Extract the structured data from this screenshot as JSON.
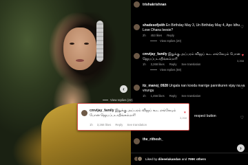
{
  "header": {
    "username": "trishakrishnan"
  },
  "comments": [
    {
      "user": "shadesofjoith",
      "text": "En Birthday May 3, Un Birthday May 4, Apo Idhu Love Dhana leesie?",
      "time": "2h",
      "likes": "453 likes",
      "reply": "Reply",
      "view_replies": "View replies (20)",
      "liked": false
    },
    {
      "user": "cmvijay_family",
      "text": "இதுக்கு அப்பரம் விஜய் கூட எங்கேயும் போன ஜெயப்படாதீங்கம்மா!!",
      "time": "1h",
      "likes": "3,268 likes",
      "reply": "Reply",
      "translate": "See translation",
      "view_replies": "View replies (59)",
      "liked": true,
      "like_count": "3,268"
    },
    {
      "user": "itz_manoj_0928",
      "text": "Ungala nan kooda marrige pannikuren vijay na va virungu",
      "time": "1h",
      "likes": "1,456 likes",
      "reply": "Reply",
      "translate": "See translation",
      "liked": false
    },
    {
      "user": "",
      "text": "respect button",
      "time": "",
      "liked": false
    },
    {
      "user": "the_rithesh_",
      "text": "",
      "time": "",
      "liked": false
    }
  ],
  "footer": {
    "prefix": "Liked by",
    "liker": "dileeelakandan",
    "conj": "and",
    "others": "799K others"
  },
  "popup": {
    "view_replies": "View replies (22)",
    "user": "cmvijay_family",
    "text": "இதுக்கு அப்பரம் விஜய் கூட எங்கேயும் போன ஜெயப்படாதீங்கம்மா!!",
    "time": "1h",
    "likes": "3,268 likes",
    "reply": "Reply",
    "translate": "See translation",
    "like_count": "3,268"
  },
  "icons": {
    "heart": "heart-icon",
    "chevron_left": "chevron-left-icon",
    "chevron_right": "chevron-right-icon"
  },
  "colors": {
    "accent_red": "#ed4956",
    "popup_border": "#d9534f"
  }
}
